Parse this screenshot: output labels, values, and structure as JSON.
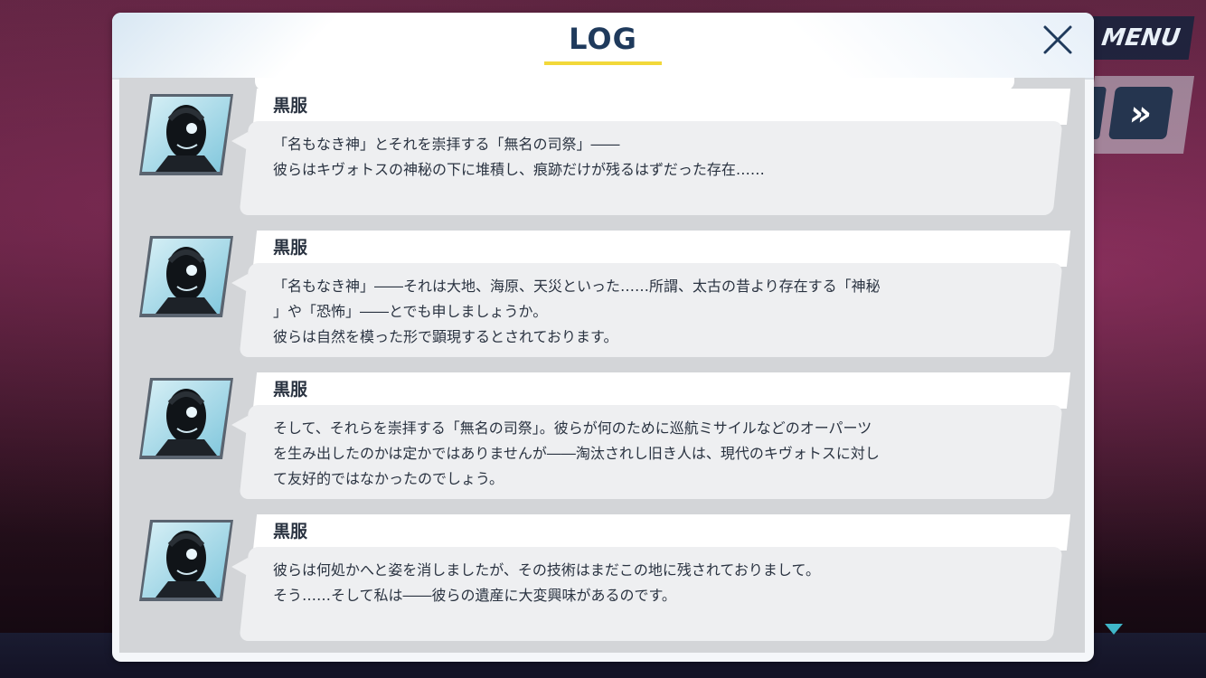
{
  "hud": {
    "menu_label": "MENU",
    "fast_forward_label": "»"
  },
  "log": {
    "title": "LOG",
    "entries": [
      {
        "speaker": "黒服",
        "lines": [
          "「名もなき神」とそれを崇拝する「無名の司祭」――",
          "彼らはキヴォトスの神秘の下に堆積し、痕跡だけが残るはずだった存在……"
        ]
      },
      {
        "speaker": "黒服",
        "lines": [
          "「名もなき神」――それは大地、海原、天災といった……所謂、太古の昔より存在する「神秘",
          "」や「恐怖」――とでも申しましょうか。",
          "彼らは自然を模った形で顕現するとされております。"
        ]
      },
      {
        "speaker": "黒服",
        "lines": [
          "そして、それらを崇拝する「無名の司祭」。彼らが何のために巡航ミサイルなどのオーパーツ",
          "を生み出したのかは定かではありませんが――淘汰されし旧き人は、現代のキヴォトスに対し",
          "て友好的ではなかったのでしょう。"
        ]
      },
      {
        "speaker": "黒服",
        "lines": [
          "彼らは何処かへと姿を消しましたが、その技術はまだこの地に残されておりまして。",
          "そう……そして私は――彼らの遺産に大変興味があるのです。"
        ]
      }
    ]
  },
  "colors": {
    "title": "#1f3a5c",
    "title_underline": "#f2d83a",
    "text": "#2a3341",
    "scroll_indicator": "#3fb6c8"
  }
}
